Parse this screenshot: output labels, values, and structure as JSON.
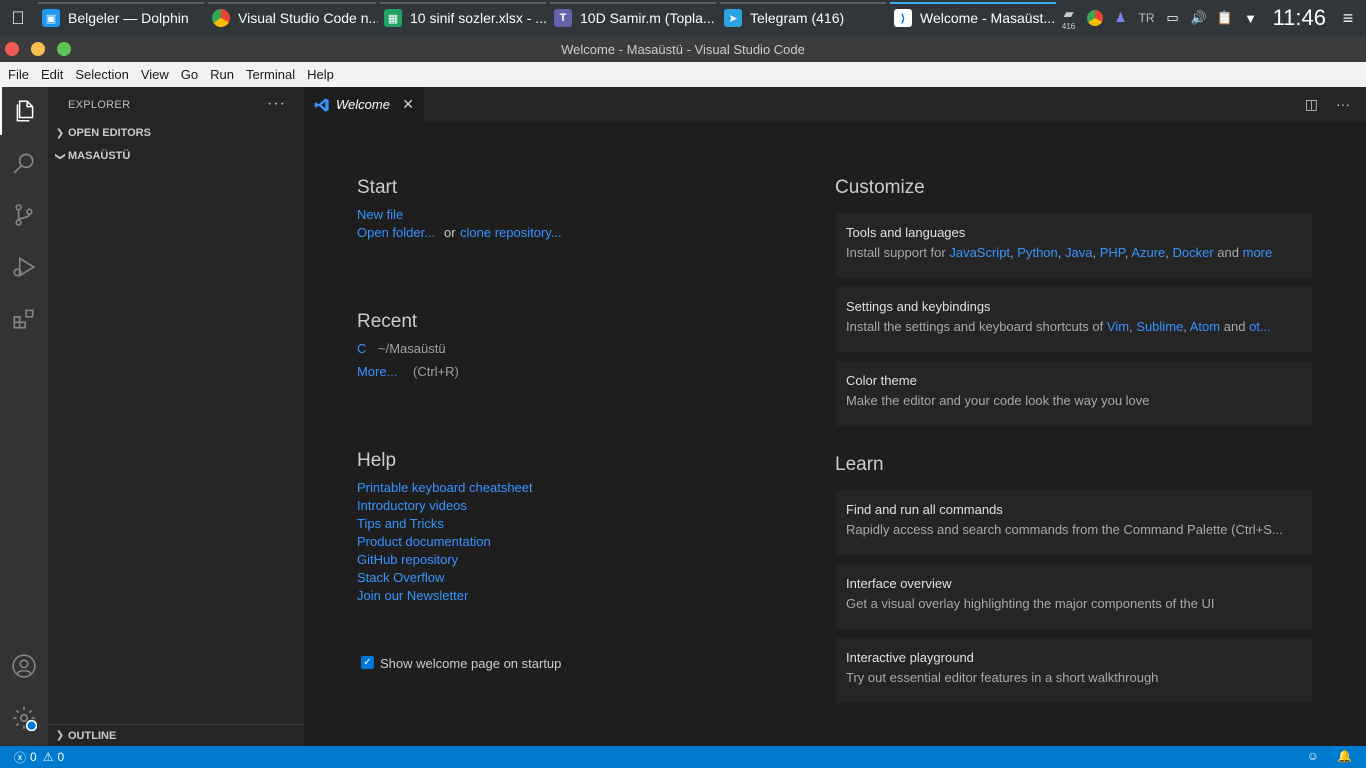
{
  "taskbar": {
    "tasks": [
      {
        "label": "Belgeler — Dolphin",
        "icon": "folder-icon",
        "color": "#1d99f3"
      },
      {
        "label": "Visual Studio Code n...",
        "icon": "chrome-icon",
        "color": "#ffffff"
      },
      {
        "label": "10 sinif sozler.xlsx - ...",
        "icon": "spreadsheet-icon",
        "color": "#21a366"
      },
      {
        "label": "10D Samir.m (Topla...",
        "icon": "teams-icon",
        "color": "#6264a7"
      },
      {
        "label": "Telegram (416)",
        "icon": "telegram-icon",
        "color": "#2aa3e0"
      },
      {
        "label": "Welcome - Masaüst...",
        "icon": "vscode-icon",
        "color": "#ffffff"
      }
    ],
    "tray_badge": "416",
    "language": "TR",
    "time": "11:46"
  },
  "window": {
    "title": "Welcome - Masaüstü - Visual Studio Code"
  },
  "menu": [
    "File",
    "Edit",
    "Selection",
    "View",
    "Go",
    "Run",
    "Terminal",
    "Help"
  ],
  "sidebar": {
    "title": "EXPLORER",
    "sections": [
      "OPEN EDITORS",
      "MASAÜSTÜ"
    ],
    "outline": "OUTLINE"
  },
  "tab": {
    "label": "Welcome"
  },
  "welcome": {
    "start": {
      "heading": "Start",
      "new_file": "New file",
      "open_folder": "Open folder...",
      "or": "or",
      "clone": "clone repository..."
    },
    "recent": {
      "heading": "Recent",
      "item_name": "C",
      "item_path": "~/Masaüstü",
      "more": "More...",
      "more_shortcut": "(Ctrl+R)"
    },
    "help": {
      "heading": "Help",
      "links": [
        "Printable keyboard cheatsheet",
        "Introductory videos",
        "Tips and Tricks",
        "Product documentation",
        "GitHub repository",
        "Stack Overflow",
        "Join our Newsletter"
      ]
    },
    "startup_checkbox": "Show welcome page on startup",
    "customize": {
      "heading": "Customize",
      "tools_title": "Tools and languages",
      "tools_prefix": "Install support for",
      "tools_links": [
        "JavaScript",
        "Python",
        "Java",
        "PHP",
        "Azure",
        "Docker"
      ],
      "tools_and": "and",
      "tools_more": "more",
      "settings_title": "Settings and keybindings",
      "settings_prefix": "Install the settings and keyboard shortcuts of",
      "settings_links": [
        "Vim",
        "Sublime",
        "Atom"
      ],
      "settings_and": "and",
      "settings_more": "ot...",
      "theme_title": "Color theme",
      "theme_desc": "Make the editor and your code look the way you love"
    },
    "learn": {
      "heading": "Learn",
      "cards": [
        {
          "title": "Find and run all commands",
          "desc": "Rapidly access and search commands from the Command Palette (Ctrl+S..."
        },
        {
          "title": "Interface overview",
          "desc": "Get a visual overlay highlighting the major components of the UI"
        },
        {
          "title": "Interactive playground",
          "desc": "Try out essential editor features in a short walkthrough"
        }
      ]
    }
  },
  "status": {
    "errors": "0",
    "warnings": "0"
  },
  "colors": {
    "accent": "#007acc",
    "link": "#3794ff"
  }
}
